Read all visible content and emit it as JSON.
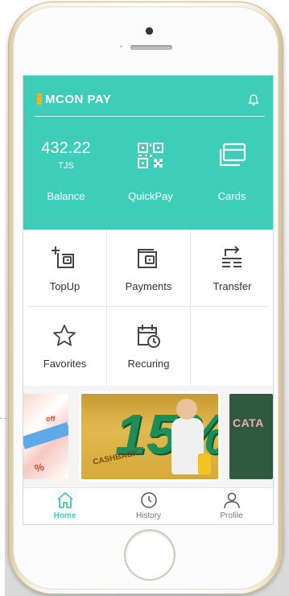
{
  "app": {
    "name": "MCON PAY"
  },
  "header": {
    "balance": {
      "amount": "432.22",
      "currency": "TJS",
      "label": "Balance"
    },
    "quickpay": {
      "label": "QuickPay",
      "icon": "qr-code-icon"
    },
    "cards": {
      "label": "Cards",
      "icon": "cards-icon"
    },
    "notification_icon": "bell-icon"
  },
  "grid": [
    {
      "label": "TopUp",
      "icon": "wallet-plus-icon"
    },
    {
      "label": "Payments",
      "icon": "wallet-icon"
    },
    {
      "label": "Transfer",
      "icon": "transfer-icon"
    },
    {
      "label": "Favorites",
      "icon": "star-icon"
    },
    {
      "label": "Recuring",
      "icon": "calendar-clock-icon"
    }
  ],
  "banners": {
    "left": {
      "texts": [
        "off",
        "%"
      ]
    },
    "center": {
      "number": "15%",
      "caption": "CASHBACK"
    },
    "right": {
      "text": "CATA"
    }
  },
  "bottom_nav": [
    {
      "label": "Home",
      "icon": "home-icon",
      "active": true
    },
    {
      "label": "History",
      "icon": "clock-icon",
      "active": false
    },
    {
      "label": "Profile",
      "icon": "user-icon",
      "active": false
    }
  ],
  "colors": {
    "accent": "#3ecdb9",
    "logo_yellow": "#f2b417",
    "text_dark": "#333333",
    "nav_inactive": "#777777"
  }
}
